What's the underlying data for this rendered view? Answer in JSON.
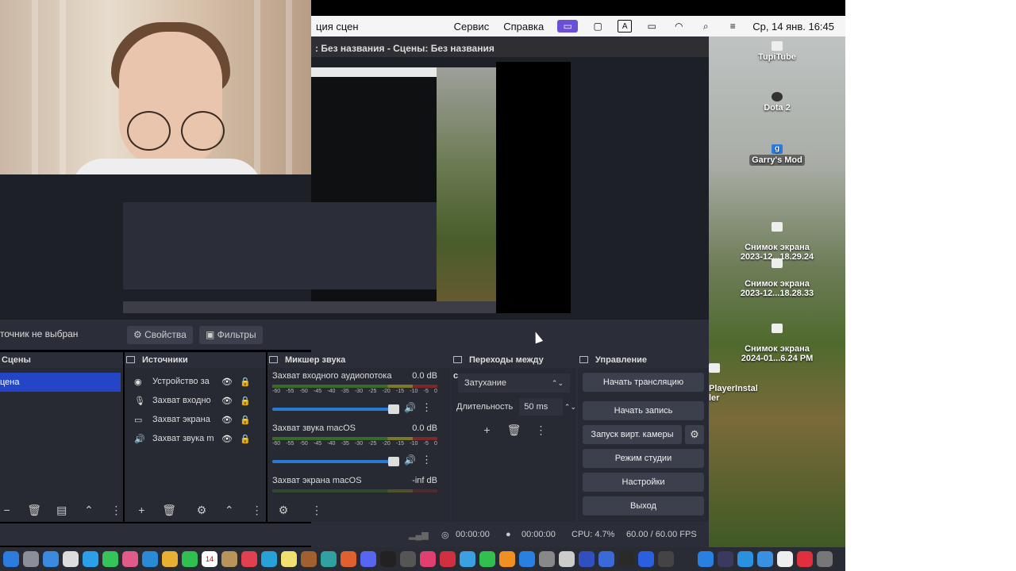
{
  "menubar": {
    "app_title": "ция сцен",
    "menus": [
      "Сервис",
      "Справка"
    ],
    "clock": "Ср, 14 янв. 16:45"
  },
  "obs": {
    "titlebar": ": Без названия - Сцены: Без названия",
    "no_source": "точник не выбран",
    "properties_btn": "Свойства",
    "filters_btn": "Фильтры"
  },
  "scenes": {
    "header": "Сцены",
    "items": [
      "цена"
    ]
  },
  "sources": {
    "header": "Источники",
    "items": [
      {
        "name": "Устройство за",
        "icon": "camera-icon"
      },
      {
        "name": "Захват входно",
        "icon": "mic-icon"
      },
      {
        "name": "Захват экрана",
        "icon": "monitor-icon"
      },
      {
        "name": "Захват звука m",
        "icon": "speaker-icon"
      }
    ]
  },
  "mixer": {
    "header": "Микшер звука",
    "channels": [
      {
        "name": "Захват входного аудиопотока",
        "db": "0.0 dB",
        "level": 0.85
      },
      {
        "name": "Захват звука macOS",
        "db": "0.0 dB",
        "level": 0.85
      },
      {
        "name": "Захват экрана macOS",
        "db": "-inf dB",
        "level": 0
      }
    ],
    "scale": [
      "-60",
      "-55",
      "-50",
      "-45",
      "-40",
      "-35",
      "-30",
      "-25",
      "-20",
      "-15",
      "-10",
      "-5",
      "0"
    ]
  },
  "transitions": {
    "header": "Переходы между сцена...",
    "selected": "Затухание",
    "duration_label": "Длительность",
    "duration_value": "50 ms"
  },
  "controls": {
    "header": "Управление",
    "start_stream": "Начать трансляцию",
    "start_record": "Начать запись",
    "virtual_cam": "Запуск вирт. камеры",
    "studio_mode": "Режим студии",
    "settings": "Настройки",
    "exit": "Выход"
  },
  "status": {
    "stream_time": "00:00:00",
    "record_time": "00:00:00",
    "cpu": "CPU: 4.7%",
    "fps": "60.00 / 60.00 FPS"
  },
  "desktop": {
    "icons": [
      {
        "label": "TupiTube"
      },
      {
        "label": "Dota 2"
      },
      {
        "label": "Garry's Mod"
      },
      {
        "label": "Снимок экрана\n2023-12...18.29.24"
      },
      {
        "label": "Снимок экрана\n2023-12...18.28.33"
      },
      {
        "label": "Снимок экрана\n2024-01...6.24 PM"
      },
      {
        "label": "PlayerInstal\nler"
      }
    ]
  },
  "colors": {
    "accent": "#2445c5",
    "panel": "#272a33",
    "toolbar": "#2b2e38"
  }
}
